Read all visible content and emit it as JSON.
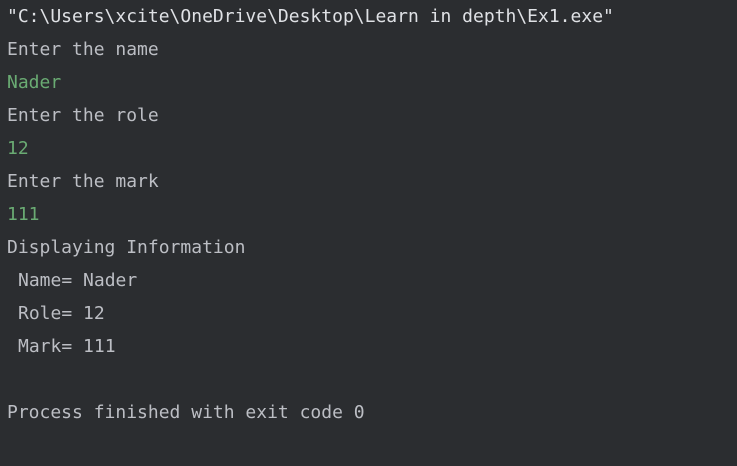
{
  "console": {
    "command_path": "\"C:\\Users\\xcite\\OneDrive\\Desktop\\Learn in depth\\Ex1.exe\"",
    "prompt_name": "Enter the name",
    "input_name": "Nader",
    "prompt_role": "Enter the role",
    "input_role": "12",
    "prompt_mark": "Enter the mark",
    "input_mark": "111",
    "display_header": "Displaying Information",
    "output_name": "Name= Nader",
    "output_role": "Role= 12",
    "output_mark": "Mark= 111",
    "process_status": "Process finished with exit code 0"
  },
  "colors": {
    "background": "#2b2d30",
    "text": "#bcbec4",
    "input_text": "#6aab73"
  }
}
